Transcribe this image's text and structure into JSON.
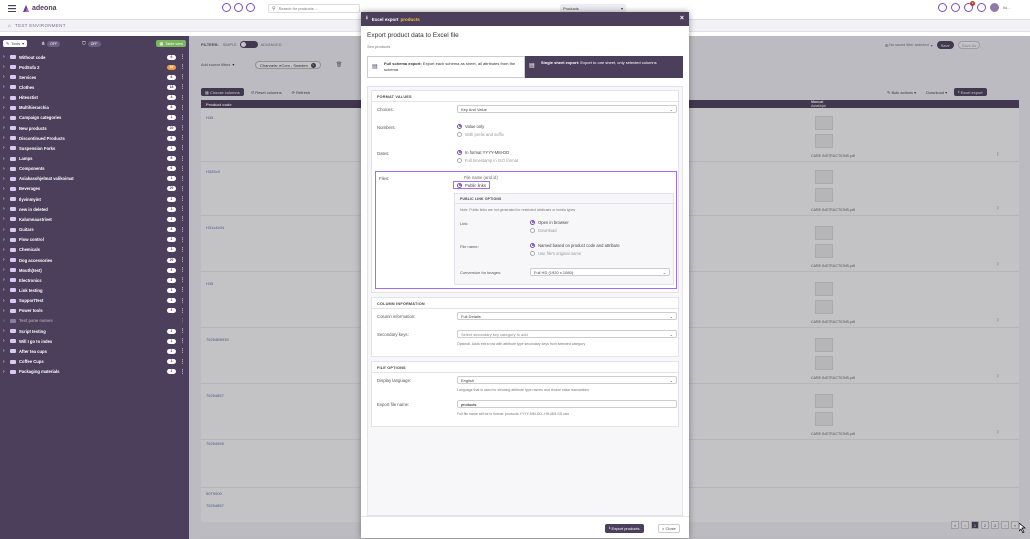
{
  "topbar": {
    "logo": "adeona",
    "search_placeholder": "Search for products ...",
    "selector_label": "Products",
    "notif_badge": "2",
    "user": "Ilu..."
  },
  "env": {
    "label": "TEST ENVIRONMENT"
  },
  "sidebar": {
    "tools_label": "Tools",
    "toggle1": "OFF",
    "toggle2": "OFF",
    "table_view": "Table view",
    "items": [
      {
        "label": "Without code",
        "count": "6"
      },
      {
        "label": "PodSofa 2",
        "count": "10",
        "orange": true
      },
      {
        "label": "Services",
        "count": "6"
      },
      {
        "label": "Clothes",
        "count": "18"
      },
      {
        "label": "Hitesstist",
        "count": "4"
      },
      {
        "label": "Multihierarchia",
        "count": "8"
      },
      {
        "label": "Campaign categories",
        "count": "1"
      },
      {
        "label": "New products",
        "count": "20"
      },
      {
        "label": "Discontinued Products",
        "count": "6"
      },
      {
        "label": "Suspension Forks",
        "count": "1"
      },
      {
        "label": "Lamps",
        "count": "8"
      },
      {
        "label": "Components",
        "count": "6"
      },
      {
        "label": "Asiakasohjelmat valikoimat",
        "count": "1"
      },
      {
        "label": "Beverages",
        "count": "20"
      },
      {
        "label": "Ilyvinmyint",
        "count": "1"
      },
      {
        "label": "new in deleted",
        "count": "1"
      },
      {
        "label": "Kalumnaustrivet",
        "count": "1"
      },
      {
        "label": "Guitars",
        "count": "4"
      },
      {
        "label": "Flow control",
        "count": "1"
      },
      {
        "label": "Chemicals",
        "count": "1"
      },
      {
        "label": "Dog accessories",
        "count": "20"
      },
      {
        "label": "Mouth(test)",
        "count": "1"
      },
      {
        "label": "Electronics",
        "count": "1"
      },
      {
        "label": "Link testing",
        "count": "1"
      },
      {
        "label": "SupportTest",
        "count": "1"
      },
      {
        "label": "Power tools",
        "count": "1"
      },
      {
        "label": "Test pane names",
        "count": "",
        "dim": true
      },
      {
        "label": "Script testing",
        "count": "1"
      },
      {
        "label": "Will I go to index",
        "count": "1"
      },
      {
        "label": "After tea cups",
        "count": "1"
      },
      {
        "label": "Coffee Cups",
        "count": "1"
      },
      {
        "label": "Packaging materials",
        "count": "1"
      }
    ]
  },
  "main": {
    "filters_label": "FILTERS:",
    "simple": "SIMPLE",
    "advanced": "ADVANCED",
    "no_saved_filter": "No saved filter selected",
    "save": "Save",
    "save_as": "Save As",
    "add_source_label": "Add source filters",
    "chip": "Channels: eCom - Sweden",
    "choose_columns": "Choose columns",
    "reset_columns": "Reset columns",
    "refresh": "Refresh",
    "bulk_actions": "Bulk actions",
    "download": "Download",
    "excel_export": "Excel export",
    "col_product_code": "Product code",
    "col_manual": "Manual",
    "col_manual2": "Asiakirjat",
    "rows": [
      "H35",
      "H325x3",
      "H31x4x04",
      "H35",
      "75254B9939",
      "75254857",
      "75254955",
      "50T9900",
      "75254857"
    ],
    "file_label": "CARE INSTRUCTIONS.pdf",
    "pagination": [
      "«",
      "‹",
      "1",
      "2",
      "3",
      "›",
      "»"
    ]
  },
  "modal": {
    "header_prefix": "Excel export",
    "header_entity": "products",
    "title": "Export product data to Excel file",
    "subtitle": "Sim products",
    "tab_full_bold": "Full schema export:",
    "tab_full_text": "Export each schema as sheet, all attributes from the schema",
    "tab_single_bold": "Single sheet export:",
    "tab_single_text": "Export to one sheet, only selected columns",
    "format_values": "FORMAT VALUES",
    "choices_label": "Choices:",
    "choices_value": "Key And Value",
    "numbers_label": "Numbers:",
    "numbers_opt1": "Value only",
    "numbers_opt2": "With prefix and suffix",
    "dates_label": "Dates:",
    "dates_opt1": "In format YYYY-MM-DD",
    "dates_opt2": "Full timestamp in ISO format",
    "files_label": "Files:",
    "files_opt1": "File name (and id)",
    "files_opt2": "Public links",
    "public_link_options": "PUBLIC LINK OPTIONS",
    "public_note": "Note: Public links are not generated for restricted attributes or media types",
    "link_label": "Link:",
    "link_opt1": "Open in browser",
    "link_opt2": "Download",
    "filename_label": "File name:",
    "filename_opt1": "Named based on product code and attribute",
    "filename_opt2": "Use file's original name",
    "conversion_label": "Conversion for images:",
    "conversion_value": "Full HD (1920 x 1080)",
    "column_information": "COLUMN INFORMATION",
    "column_info_label": "Column information:",
    "column_info_value": "Full Details",
    "secondary_label": "Secondary keys:",
    "secondary_placeholder": "Select secondary key category to add",
    "secondary_hint": "Optional. Adds extra row with attribute type secondary keys from selected category",
    "file_options": "FILE OPTIONS",
    "display_lang_label": "Display language:",
    "display_lang_value": "English",
    "display_lang_hint": "Language that is used for showing attribute type names and choice value translations",
    "export_name_label": "Export file name:",
    "export_name_value": "products",
    "export_name_hint": "Full file name will be in format: products-YYYY-MM-DD--HH-MM-SS.xlsx",
    "export_button": "Export products",
    "close_button": "Close"
  },
  "colors": {
    "brand": "#4b3f5c",
    "accent": "#9b59d6",
    "highlight": "#a46cf0"
  }
}
